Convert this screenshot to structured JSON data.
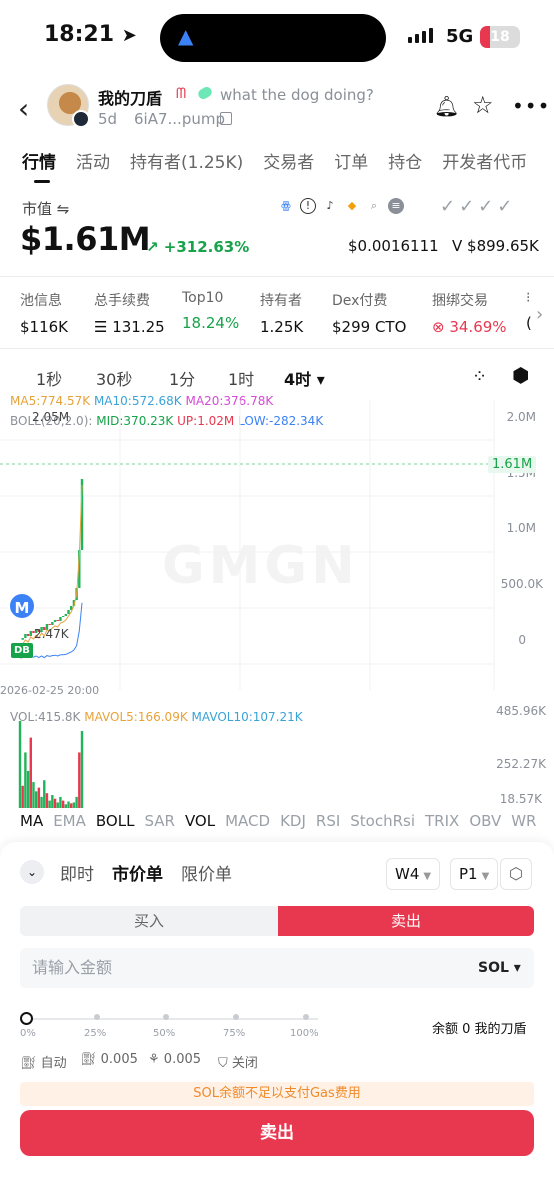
{
  "status_bar": {
    "time": "18:21",
    "network": "5G",
    "battery": "18"
  },
  "header": {
    "name": "我的刀盾",
    "emoji": "ᗰ",
    "description": "what the dog doing?",
    "age": "5d",
    "address": "6iA7...pump"
  },
  "tabs": [
    "行情",
    "活动",
    "持有者(1.25K)",
    "交易者",
    "订单",
    "持仓",
    "开发者代币"
  ],
  "market": {
    "cap_label": "市值 ⇋",
    "cap_value": "$1.61M",
    "change": "↗ +312.63%",
    "price": "$0.0016111",
    "volume": "V $899.65K"
  },
  "stats": [
    {
      "label": "池信息",
      "value": "$116K"
    },
    {
      "label": "总手续费",
      "value": "☰ 131.25"
    },
    {
      "label": "Top10",
      "value": "18.24%"
    },
    {
      "label": "持有者",
      "value": "1.25K"
    },
    {
      "label": "Dex付费",
      "value": "$299 CTO"
    },
    {
      "label": "捆绑交易",
      "value": "⊗ 34.69%"
    },
    {
      "label": "⁝",
      "value": "("
    }
  ],
  "timeframes": [
    "1秒",
    "30秒",
    "1分",
    "1时",
    "4时 ▾"
  ],
  "indicators": {
    "ma5": "MA5:774.57K",
    "ma10": "MA10:572.68K",
    "ma20": "MA20:376.78K",
    "boll": "BOLL(20,2.0):",
    "mid": "MID:370.23K",
    "up": "UP:1.02M",
    "low": "LOW:-282.34K"
  },
  "chart_data": {
    "type": "line",
    "title": "",
    "y_ticks": [
      "2.0M",
      "1.5M",
      "1.0M",
      "500.0K",
      "0"
    ],
    "current_price_label": "1.61M",
    "high_label": "2.05M",
    "low_label": "2.47K",
    "date_label": "2026-02-25 20:00",
    "watermark": "GMGN",
    "markers": [
      "M",
      "DB"
    ],
    "x": [
      1,
      2,
      3,
      4,
      5,
      6,
      7,
      8,
      9,
      10,
      11,
      12,
      13,
      14,
      15,
      16,
      17,
      18,
      19,
      20,
      21,
      22,
      23,
      24
    ],
    "series": [
      {
        "values": [
          2.47,
          20,
          60,
          40,
          90,
          70,
          110,
          80,
          130,
          100,
          160,
          150,
          180,
          200,
          190,
          230,
          240,
          260,
          300,
          340,
          400,
          520,
          900,
          1610
        ]
      }
    ],
    "volume": {
      "vol": "VOL:415.8K",
      "mavol5": "MAVOL5:166.09K",
      "mavol10": "MAVOL10:107.21K",
      "y_ticks": [
        "485.96K",
        "252.27K",
        "18.57K"
      ],
      "values": [
        470,
        120,
        300,
        200,
        380,
        140,
        90,
        110,
        60,
        150,
        80,
        40,
        70,
        50,
        30,
        60,
        40,
        20,
        35,
        25,
        30,
        60,
        300,
        415.8
      ]
    }
  },
  "indicator_tabs": [
    "MA",
    "EMA",
    "BOLL",
    "SAR",
    "VOL",
    "MACD",
    "KDJ",
    "RSI",
    "StochRsi",
    "TRIX",
    "OBV",
    "WR"
  ],
  "trade": {
    "order_tabs": [
      "即时",
      "市价单",
      "限价单"
    ],
    "w_select": "W4",
    "p_select": "P1",
    "buy_label": "买入",
    "sell_label": "卖出",
    "amount_placeholder": "请输入金额",
    "amount_unit": "SOL ▾",
    "percent_marks": [
      "0%",
      "25%",
      "50%",
      "75%",
      "100%"
    ],
    "balance": "余额 0 我的刀盾",
    "auto": "自动",
    "gas": "0.005",
    "tip": "0.005",
    "mev": "关闭",
    "warning": "SOL余额不足以支付Gas费用",
    "submit": "卖出"
  }
}
